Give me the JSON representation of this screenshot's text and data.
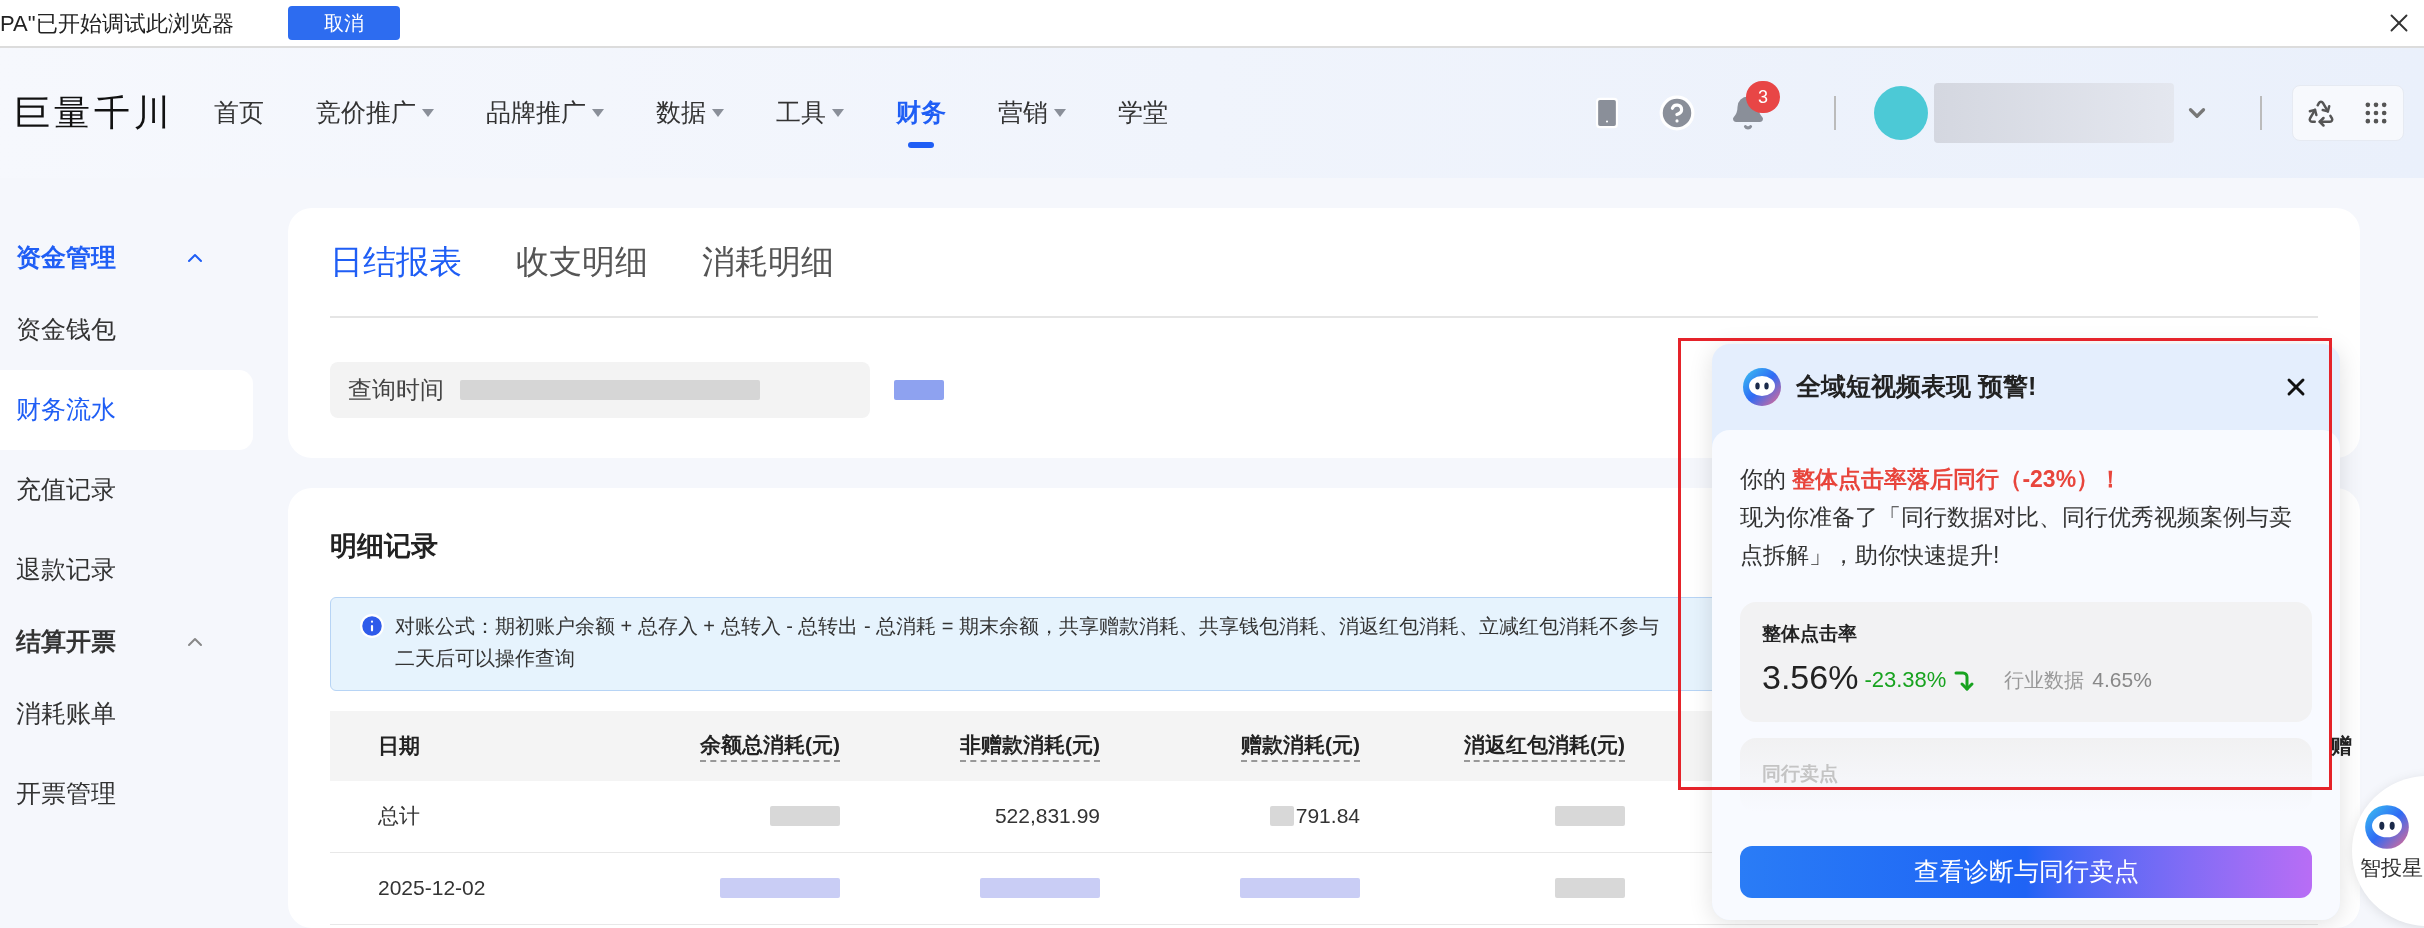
{
  "debug_bar": {
    "message": "PA\"已开始调试此浏览器",
    "cancel_button": "取消"
  },
  "header": {
    "logo": "巨量千川",
    "nav": [
      {
        "label": "首页",
        "dropdown": false,
        "selected": false
      },
      {
        "label": "竞价推广",
        "dropdown": true,
        "selected": false
      },
      {
        "label": "品牌推广",
        "dropdown": true,
        "selected": false
      },
      {
        "label": "数据",
        "dropdown": true,
        "selected": false
      },
      {
        "label": "工具",
        "dropdown": true,
        "selected": false
      },
      {
        "label": "财务",
        "dropdown": false,
        "selected": true
      },
      {
        "label": "营销",
        "dropdown": true,
        "selected": false
      },
      {
        "label": "学堂",
        "dropdown": false,
        "selected": false
      }
    ],
    "notification_count": "3"
  },
  "sidebar": {
    "groups": [
      {
        "title": "资金管理",
        "expanded": true,
        "selected": true,
        "items": [
          {
            "label": "资金钱包",
            "selected": false
          },
          {
            "label": "财务流水",
            "selected": true
          },
          {
            "label": "充值记录",
            "selected": false
          },
          {
            "label": "退款记录",
            "selected": false
          }
        ]
      },
      {
        "title": "结算开票",
        "expanded": true,
        "selected": false,
        "items": [
          {
            "label": "消耗账单",
            "selected": false
          },
          {
            "label": "开票管理",
            "selected": false
          }
        ]
      }
    ]
  },
  "tabs": [
    {
      "label": "日结报表",
      "selected": true
    },
    {
      "label": "收支明细",
      "selected": false
    },
    {
      "label": "消耗明细",
      "selected": false
    }
  ],
  "query": {
    "label": "查询时间"
  },
  "records": {
    "title": "明细记录",
    "notice": [
      "对账公式：期初账户余额 + 总存入 + 总转入 - 总转出 - 总消耗 = 期末余额，共享赠款消耗、共享钱包消耗、消返红包消耗、立减红包消耗不参与",
      "二天后可以操作查询"
    ],
    "columns": [
      "日期",
      "余额总消耗(元)",
      "非赠款消耗(元)",
      "赠款消耗(元)",
      "消返红包消耗(元)"
    ],
    "column_6": "赠",
    "rows": [
      {
        "cells": [
          {
            "kind": "text",
            "text": "总计"
          },
          {
            "kind": "blurred"
          },
          {
            "kind": "text",
            "text": "522,831.99"
          },
          {
            "kind": "partial",
            "text": "791.84"
          },
          {
            "kind": "blurred"
          }
        ]
      },
      {
        "cells": [
          {
            "kind": "text",
            "text": "2025-12-02"
          },
          {
            "kind": "blurred_link"
          },
          {
            "kind": "blurred_link"
          },
          {
            "kind": "blurred_link"
          },
          {
            "kind": "blurred"
          }
        ]
      }
    ]
  },
  "popup": {
    "title": "全域短视频表现 预警!",
    "intro": "你的 **整体点击率落后同行（-23%）！**",
    "body": "现为你准备了「同行数据对比、同行优秀视频案例与卖点拆解」，助你快速提升!",
    "metric": {
      "label": "整体点击率",
      "value": "3.56%",
      "change": "-23.38%",
      "falling": true,
      "benchmark_label": "行业数据",
      "benchmark_value": "4.65%"
    },
    "peer_section": "同行卖点",
    "cta": "查看诊断与同行卖点"
  },
  "assistant": {
    "label": "智投星"
  }
}
